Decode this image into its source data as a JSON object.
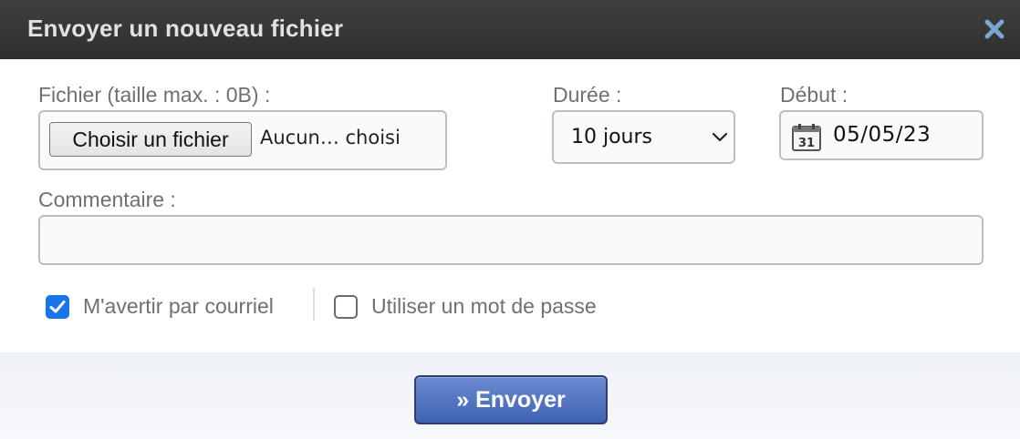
{
  "dialog": {
    "title": "Envoyer un nouveau fichier",
    "close_icon": "close-x-icon"
  },
  "file": {
    "label": "Fichier (taille max. : 0B) :",
    "button_label": "Choisir un fichier",
    "status": "Aucun… choisi"
  },
  "duration": {
    "label": "Durée :",
    "selected": "10 jours"
  },
  "start": {
    "label": "Début :",
    "value": "05/05/23",
    "icon": "calendar-icon",
    "icon_text": "31"
  },
  "comment": {
    "label": "Commentaire :",
    "value": ""
  },
  "options": {
    "notify": {
      "label": "M'avertir par courriel",
      "checked": true
    },
    "password": {
      "label": "Utiliser un mot de passe",
      "checked": false
    }
  },
  "submit": {
    "label": "» Envoyer"
  },
  "colors": {
    "accent": "#1a73e8",
    "titlebar": "#333333",
    "button": "#4a6cc0"
  }
}
